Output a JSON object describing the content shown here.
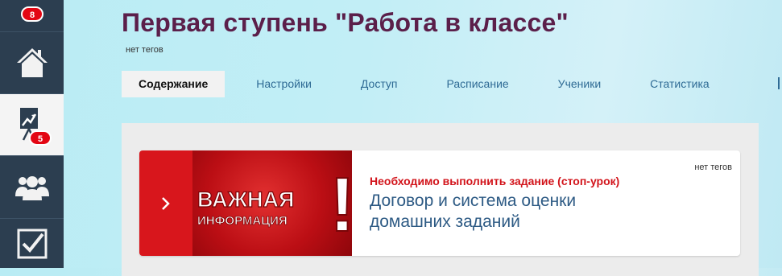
{
  "sidebar": {
    "badge_top": "8",
    "badge_progress": "5",
    "items": [
      {
        "icon": "home-icon"
      },
      {
        "icon": "chart-board-icon"
      },
      {
        "icon": "users-icon"
      },
      {
        "icon": "checkbox-icon"
      }
    ]
  },
  "page": {
    "title": "Первая ступень \"Работа в классе\"",
    "tags": "нет тегов"
  },
  "tabs": [
    {
      "label": "Содержание"
    },
    {
      "label": "Настройки"
    },
    {
      "label": "Доступ"
    },
    {
      "label": "Расписание"
    },
    {
      "label": "Ученики"
    },
    {
      "label": "Статистика"
    }
  ],
  "lesson": {
    "tags": "нет тегов",
    "subtitle": "Необходимо выполнить задание (стоп-урок)",
    "title": "Договор и система оценки домашних заданий",
    "banner_line1": "ВАЖНАЯ",
    "banner_line2": "ИНФОРМАЦИЯ",
    "banner_mark": "!"
  },
  "colors": {
    "sidebar_bg": "#2c3e50",
    "title": "#5b1f4a",
    "tab_link": "#2f6b95",
    "accent_red": "#d8161c",
    "lesson_title": "#2d5a84"
  }
}
